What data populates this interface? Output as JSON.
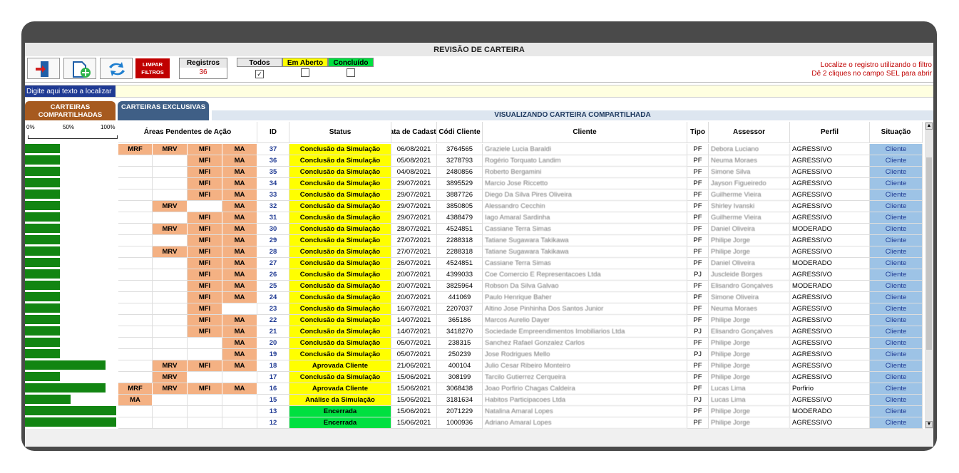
{
  "title": "REVISÃO DE CARTEIRA",
  "toolbar": {
    "limpar_label": "LIMPAR FILTROS",
    "registros_label": "Registros",
    "registros_value": "36",
    "filter_todos": "Todos",
    "filter_aberto": "Em Aberto",
    "filter_concluido": "Concluído",
    "hint1": "Localize o registro utilizando o filtro",
    "hint2": "Dê 2 cliques no campo SEL para abrir"
  },
  "search": {
    "placeholder": "Digite aqui texto a localizar"
  },
  "tabs": {
    "compart": "CARTEIRAS COMPARTILHADAS",
    "excl": "CARTEIRAS EXCLUSIVAS"
  },
  "view_label": "VISUALIZANDO CARTEIRA COMPARTILHADA",
  "pct": {
    "p0": "0%",
    "p50": "50%",
    "p100": "100%"
  },
  "headers": {
    "areas": "Áreas Pendentes de Ação",
    "id": "ID",
    "status": "Status",
    "data": "Data de Cadastro",
    "codi": "Códi Cliente",
    "cliente": "Cliente",
    "tipo": "Tipo",
    "assessor": "Assessor",
    "perfil": "Perfil",
    "situacao": "Situação"
  },
  "rows": [
    {
      "a1": "MRF",
      "a2": "MRV",
      "a3": "MFI",
      "a4": "MA",
      "id": "37",
      "status": "Conclusão da Simulação",
      "st": "sim",
      "data": "06/08/2021",
      "cod": "3764565",
      "cliente": "Graziele Lucia Baraldi",
      "tipo": "PF",
      "assessor": "Debora Luciano",
      "perfil": "AGRESSIVO",
      "sit": "Cliente",
      "bar": 0.38
    },
    {
      "a1": "",
      "a2": "",
      "a3": "MFI",
      "a4": "MA",
      "id": "36",
      "status": "Conclusão da Simulação",
      "st": "sim",
      "data": "05/08/2021",
      "cod": "3278793",
      "cliente": "Rogério Torquato Landim",
      "tipo": "PF",
      "assessor": "Neuma Moraes",
      "perfil": "AGRESSIVO",
      "sit": "Cliente",
      "bar": 0.38
    },
    {
      "a1": "",
      "a2": "",
      "a3": "MFI",
      "a4": "MA",
      "id": "35",
      "status": "Conclusão da Simulação",
      "st": "sim",
      "data": "04/08/2021",
      "cod": "2480856",
      "cliente": "Roberto Bergamini",
      "tipo": "PF",
      "assessor": "Simone Silva",
      "perfil": "AGRESSIVO",
      "sit": "Cliente",
      "bar": 0.38
    },
    {
      "a1": "",
      "a2": "",
      "a3": "MFI",
      "a4": "MA",
      "id": "34",
      "status": "Conclusão da Simulação",
      "st": "sim",
      "data": "29/07/2021",
      "cod": "3895529",
      "cliente": "Marcio Jose Riccetto",
      "tipo": "PF",
      "assessor": "Jayson Figueiredo",
      "perfil": "AGRESSIVO",
      "sit": "Cliente",
      "bar": 0.38
    },
    {
      "a1": "",
      "a2": "",
      "a3": "MFI",
      "a4": "MA",
      "id": "33",
      "status": "Conclusão da Simulação",
      "st": "sim",
      "data": "29/07/2021",
      "cod": "3887726",
      "cliente": "Diego Da Silva Pires Oliveira",
      "tipo": "PF",
      "assessor": "Guilherme Vieira",
      "perfil": "AGRESSIVO",
      "sit": "Cliente",
      "bar": 0.38
    },
    {
      "a1": "",
      "a2": "MRV",
      "a3": "",
      "a4": "MA",
      "id": "32",
      "status": "Conclusão da Simulação",
      "st": "sim",
      "data": "29/07/2021",
      "cod": "3850805",
      "cliente": "Alessandro Cecchin",
      "tipo": "PF",
      "assessor": "Shirley Ivanski",
      "perfil": "AGRESSIVO",
      "sit": "Cliente",
      "bar": 0.38
    },
    {
      "a1": "",
      "a2": "",
      "a3": "MFI",
      "a4": "MA",
      "id": "31",
      "status": "Conclusão da Simulação",
      "st": "sim",
      "data": "29/07/2021",
      "cod": "4388479",
      "cliente": "Iago Amaral Sardinha",
      "tipo": "PF",
      "assessor": "Guilherme Vieira",
      "perfil": "AGRESSIVO",
      "sit": "Cliente",
      "bar": 0.38
    },
    {
      "a1": "",
      "a2": "MRV",
      "a3": "MFI",
      "a4": "MA",
      "id": "30",
      "status": "Conclusão da Simulação",
      "st": "sim",
      "data": "28/07/2021",
      "cod": "4524851",
      "cliente": "Cassiane Terra Simas",
      "tipo": "PF",
      "assessor": "Daniel Oliveira",
      "perfil": "MODERADO",
      "sit": "Cliente",
      "bar": 0.38
    },
    {
      "a1": "",
      "a2": "",
      "a3": "MFI",
      "a4": "MA",
      "id": "29",
      "status": "Conclusão da Simulação",
      "st": "sim",
      "data": "27/07/2021",
      "cod": "2288318",
      "cliente": "Tatiane Sugawara Takikawa",
      "tipo": "PF",
      "assessor": "Philipe Jorge",
      "perfil": "AGRESSIVO",
      "sit": "Cliente",
      "bar": 0.38
    },
    {
      "a1": "",
      "a2": "MRV",
      "a3": "MFI",
      "a4": "MA",
      "id": "28",
      "status": "Conclusão da Simulação",
      "st": "sim",
      "data": "27/07/2021",
      "cod": "2288318",
      "cliente": "Tatiane Sugawara Takikawa",
      "tipo": "PF",
      "assessor": "Philipe Jorge",
      "perfil": "AGRESSIVO",
      "sit": "Cliente",
      "bar": 0.38
    },
    {
      "a1": "",
      "a2": "",
      "a3": "MFI",
      "a4": "MA",
      "id": "27",
      "status": "Conclusão da Simulação",
      "st": "sim",
      "data": "26/07/2021",
      "cod": "4524851",
      "cliente": "Cassiane Terra Simas",
      "tipo": "PF",
      "assessor": "Daniel Oliveira",
      "perfil": "MODERADO",
      "sit": "Cliente",
      "bar": 0.38
    },
    {
      "a1": "",
      "a2": "",
      "a3": "MFI",
      "a4": "MA",
      "id": "26",
      "status": "Conclusão da Simulação",
      "st": "sim",
      "data": "20/07/2021",
      "cod": "4399033",
      "cliente": "Coe Comercio E Representacoes Ltda",
      "tipo": "PJ",
      "assessor": "Juscleide Borges",
      "perfil": "AGRESSIVO",
      "sit": "Cliente",
      "bar": 0.38
    },
    {
      "a1": "",
      "a2": "",
      "a3": "MFI",
      "a4": "MA",
      "id": "25",
      "status": "Conclusão da Simulação",
      "st": "sim",
      "data": "20/07/2021",
      "cod": "3825964",
      "cliente": "Robson Da Silva Galvao",
      "tipo": "PF",
      "assessor": "Elisandro Gonçalves",
      "perfil": "MODERADO",
      "sit": "Cliente",
      "bar": 0.38
    },
    {
      "a1": "",
      "a2": "",
      "a3": "MFI",
      "a4": "MA",
      "id": "24",
      "status": "Conclusão da Simulação",
      "st": "sim",
      "data": "20/07/2021",
      "cod": "441069",
      "cliente": "Paulo Henrique Baher",
      "tipo": "PF",
      "assessor": "Simone Oliveira",
      "perfil": "AGRESSIVO",
      "sit": "Cliente",
      "bar": 0.38
    },
    {
      "a1": "",
      "a2": "",
      "a3": "MFI",
      "a4": "",
      "id": "23",
      "status": "Conclusão da Simulação",
      "st": "sim",
      "data": "16/07/2021",
      "cod": "2207037",
      "cliente": "Altino Jose Pinhinha Dos Santos Junior",
      "tipo": "PF",
      "assessor": "Neuma Moraes",
      "perfil": "AGRESSIVO",
      "sit": "Cliente",
      "bar": 0.38
    },
    {
      "a1": "",
      "a2": "",
      "a3": "MFI",
      "a4": "MA",
      "id": "22",
      "status": "Conclusão da Simulação",
      "st": "sim",
      "data": "14/07/2021",
      "cod": "365186",
      "cliente": "Marcos Aurelio Dayer",
      "tipo": "PF",
      "assessor": "Philipe Jorge",
      "perfil": "AGRESSIVO",
      "sit": "Cliente",
      "bar": 0.38
    },
    {
      "a1": "",
      "a2": "",
      "a3": "MFI",
      "a4": "MA",
      "id": "21",
      "status": "Conclusão da Simulação",
      "st": "sim",
      "data": "14/07/2021",
      "cod": "3418270",
      "cliente": "Sociedade Empreendimentos Imobiliarios Ltda",
      "tipo": "PJ",
      "assessor": "Elisandro Gonçalves",
      "perfil": "AGRESSIVO",
      "sit": "Cliente",
      "bar": 0.38
    },
    {
      "a1": "",
      "a2": "",
      "a3": "",
      "a4": "MA",
      "id": "20",
      "status": "Conclusão da Simulação",
      "st": "sim",
      "data": "05/07/2021",
      "cod": "238315",
      "cliente": "Sanchez Rafael Gonzalez Carlos",
      "tipo": "PF",
      "assessor": "Philipe Jorge",
      "perfil": "AGRESSIVO",
      "sit": "Cliente",
      "bar": 0.38
    },
    {
      "a1": "",
      "a2": "",
      "a3": "",
      "a4": "MA",
      "id": "19",
      "status": "Conclusão da Simulação",
      "st": "sim",
      "data": "05/07/2021",
      "cod": "250239",
      "cliente": "Jose Rodrigues Mello",
      "tipo": "PJ",
      "assessor": "Philipe Jorge",
      "perfil": "AGRESSIVO",
      "sit": "Cliente",
      "bar": 0.38
    },
    {
      "a1": "",
      "a2": "MRV",
      "a3": "MFI",
      "a4": "MA",
      "id": "18",
      "status": "Aprovada Cliente",
      "st": "aprov",
      "data": "21/06/2021",
      "cod": "400104",
      "cliente": "Julio Cesar Ribeiro Monteiro",
      "tipo": "PF",
      "assessor": "Philipe Jorge",
      "perfil": "AGRESSIVO",
      "sit": "Cliente",
      "bar": 0.88
    },
    {
      "a1": "",
      "a2": "MRV",
      "a3": "",
      "a4": "",
      "id": "17",
      "status": "Conclusão da Simulação",
      "st": "sim",
      "data": "15/06/2021",
      "cod": "308199",
      "cliente": "Tarcilo Gutierrez Cerqueira",
      "tipo": "PF",
      "assessor": "Philipe Jorge",
      "perfil": "AGRESSIVO",
      "sit": "Cliente",
      "bar": 0.38
    },
    {
      "a1": "MRF",
      "a2": "MRV",
      "a3": "MFI",
      "a4": "MA",
      "id": "16",
      "status": "Aprovada Cliente",
      "st": "aprov",
      "data": "15/06/2021",
      "cod": "3068438",
      "cliente": "Joao Porfirio Chagas Caldeira",
      "tipo": "PF",
      "assessor": "Lucas Lima",
      "perfil": "Porfirio",
      "sit": "Cliente",
      "bar": 0.88
    },
    {
      "a1": "MA",
      "a2": "",
      "a3": "",
      "a4": "",
      "id": "15",
      "status": "Análise da Simulação",
      "st": "anal",
      "data": "15/06/2021",
      "cod": "3181634",
      "cliente": "Habitos Participacoes Ltda",
      "tipo": "PJ",
      "assessor": "Lucas Lima",
      "perfil": "AGRESSIVO",
      "sit": "Cliente",
      "bar": 0.5
    },
    {
      "a1": "",
      "a2": "",
      "a3": "",
      "a4": "",
      "id": "13",
      "status": "Encerrada",
      "st": "enc",
      "data": "15/06/2021",
      "cod": "2071229",
      "cliente": "Natalina Amaral Lopes",
      "tipo": "PF",
      "assessor": "Philipe Jorge",
      "perfil": "MODERADO",
      "sit": "Cliente",
      "bar": 1.0
    },
    {
      "a1": "",
      "a2": "",
      "a3": "",
      "a4": "",
      "id": "12",
      "status": "Encerrada",
      "st": "enc",
      "data": "15/06/2021",
      "cod": "1000936",
      "cliente": "Adriano Amaral Lopes",
      "tipo": "PF",
      "assessor": "Philipe Jorge",
      "perfil": "AGRESSIVO",
      "sit": "Cliente",
      "bar": 1.0
    }
  ]
}
